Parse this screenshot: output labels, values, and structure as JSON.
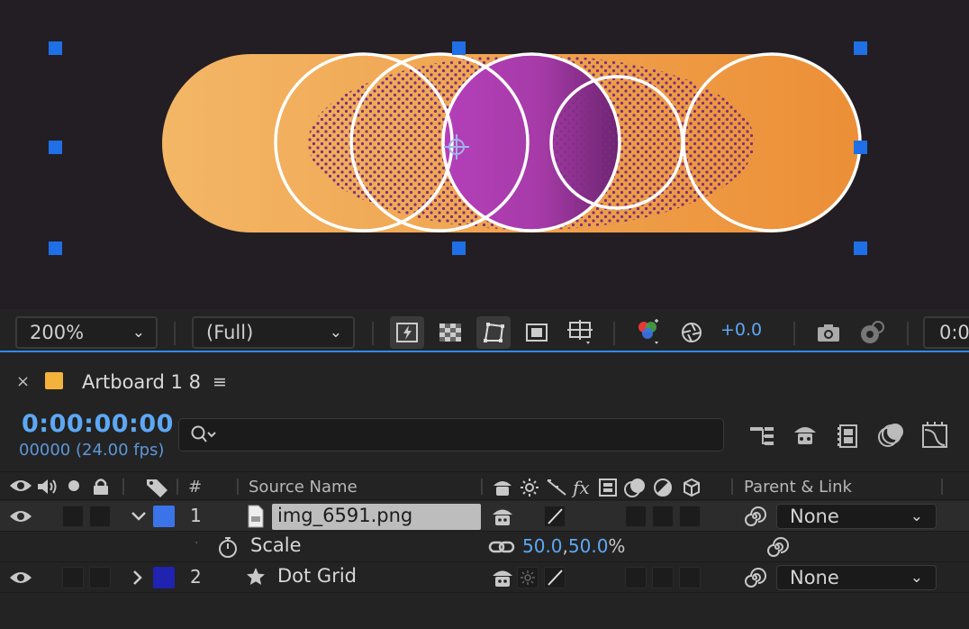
{
  "viewer": {
    "colors": {
      "background": "#231e24",
      "orange_light": "#f3b766",
      "orange_dark": "#ec8f37",
      "purple": "#b43fb9",
      "handle": "#1f6fe6"
    }
  },
  "viewer_toolbar": {
    "zoom": "200%",
    "resolution": "(Full)",
    "exposure": "+0.0",
    "timecode_partial": "0:0"
  },
  "timeline": {
    "close_label": "×",
    "comp_name": "Artboard 1 8",
    "menu_icon": "≡",
    "current_time": "0:00:00:00",
    "frame_info": "00000 (24.00 fps)",
    "search_placeholder": ""
  },
  "columns": {
    "number": "#",
    "source_name": "Source Name",
    "parent_link": "Parent & Link"
  },
  "layers": [
    {
      "number": "1",
      "name": "img_6591.png",
      "label_color": "#3b73e8",
      "expanded": true,
      "parent": "None"
    },
    {
      "number": "2",
      "name": "Dot Grid",
      "label_color": "#1f23b0",
      "expanded": false,
      "parent": "None"
    }
  ],
  "property": {
    "name": "Scale",
    "value_x": "50.0",
    "separator": ",",
    "value_y": "50.0",
    "unit": "%"
  },
  "colors": {
    "accent": "#5da8f4",
    "active_border": "#2d8ceb"
  }
}
